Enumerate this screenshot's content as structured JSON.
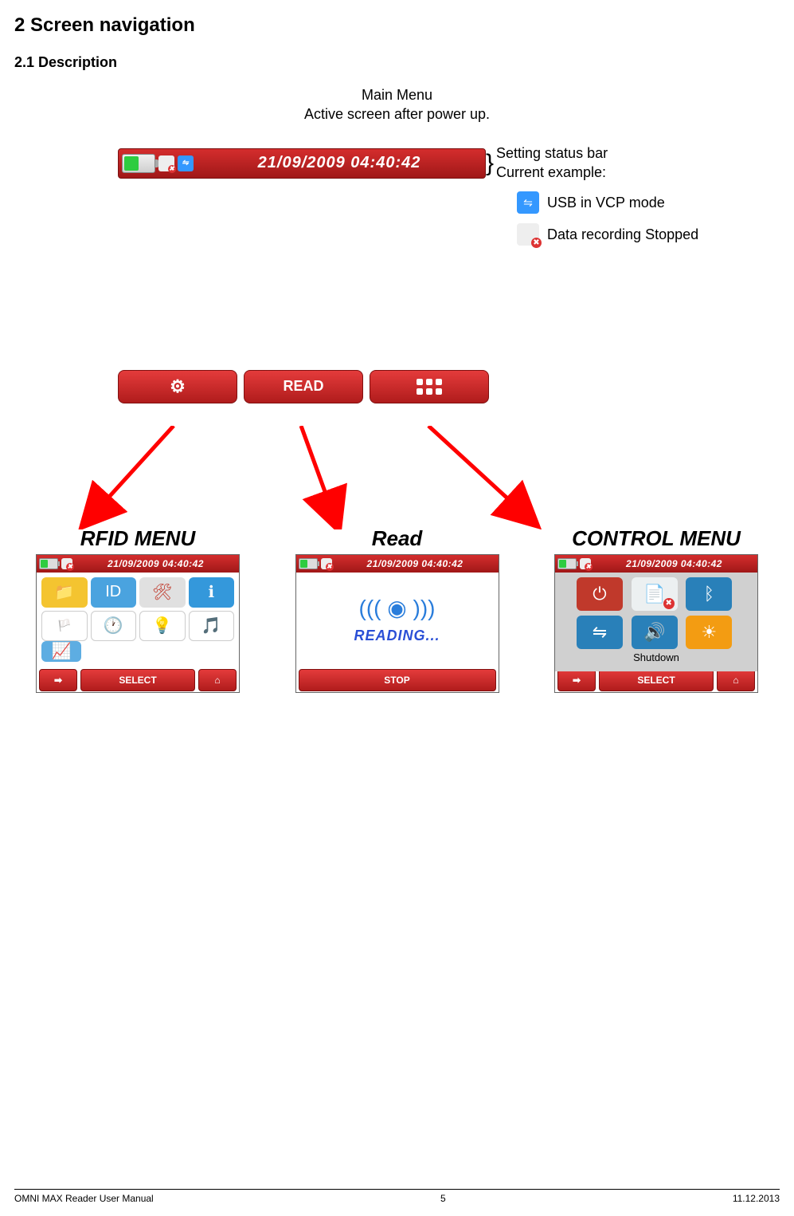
{
  "headings": {
    "section": "2   Screen navigation",
    "subsection": "2.1     Description"
  },
  "intro": {
    "line1": "Main Menu",
    "line2": "Active screen after power up."
  },
  "status_bar": {
    "datetime": "21/09/2009 04:40:42"
  },
  "side": {
    "line1": "Setting status bar",
    "line2": "Current example:",
    "usb_label": "USB in VCP mode",
    "rec_label": "Data recording Stopped"
  },
  "main_buttons": {
    "read_label": "READ"
  },
  "screen_titles": {
    "rfid": "RFID MENU",
    "read": "Read",
    "control": "CONTROL MENU"
  },
  "mini_status_datetime": "21/09/2009 04:40:42",
  "reading_label": "READING...",
  "control_label": "Shutdown",
  "footer_buttons": {
    "select": "SELECT",
    "stop": "STOP"
  },
  "page_footer": {
    "left": "OMNI MAX Reader User Manual",
    "center": "5",
    "right": "11.12.2013"
  }
}
